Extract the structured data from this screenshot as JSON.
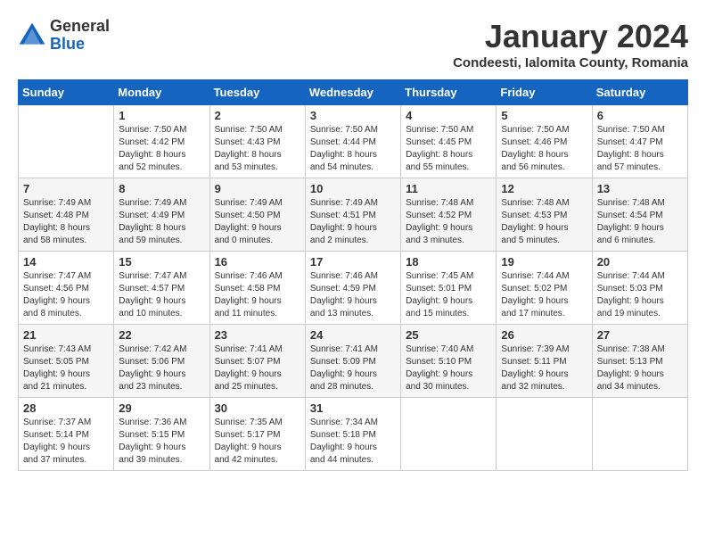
{
  "logo": {
    "general": "General",
    "blue": "Blue"
  },
  "title": "January 2024",
  "subtitle": "Condeesti, Ialomita County, Romania",
  "days_of_week": [
    "Sunday",
    "Monday",
    "Tuesday",
    "Wednesday",
    "Thursday",
    "Friday",
    "Saturday"
  ],
  "weeks": [
    [
      {
        "number": "",
        "info": ""
      },
      {
        "number": "1",
        "info": "Sunrise: 7:50 AM\nSunset: 4:42 PM\nDaylight: 8 hours\nand 52 minutes."
      },
      {
        "number": "2",
        "info": "Sunrise: 7:50 AM\nSunset: 4:43 PM\nDaylight: 8 hours\nand 53 minutes."
      },
      {
        "number": "3",
        "info": "Sunrise: 7:50 AM\nSunset: 4:44 PM\nDaylight: 8 hours\nand 54 minutes."
      },
      {
        "number": "4",
        "info": "Sunrise: 7:50 AM\nSunset: 4:45 PM\nDaylight: 8 hours\nand 55 minutes."
      },
      {
        "number": "5",
        "info": "Sunrise: 7:50 AM\nSunset: 4:46 PM\nDaylight: 8 hours\nand 56 minutes."
      },
      {
        "number": "6",
        "info": "Sunrise: 7:50 AM\nSunset: 4:47 PM\nDaylight: 8 hours\nand 57 minutes."
      }
    ],
    [
      {
        "number": "7",
        "info": "Sunrise: 7:49 AM\nSunset: 4:48 PM\nDaylight: 8 hours\nand 58 minutes."
      },
      {
        "number": "8",
        "info": "Sunrise: 7:49 AM\nSunset: 4:49 PM\nDaylight: 8 hours\nand 59 minutes."
      },
      {
        "number": "9",
        "info": "Sunrise: 7:49 AM\nSunset: 4:50 PM\nDaylight: 9 hours\nand 0 minutes."
      },
      {
        "number": "10",
        "info": "Sunrise: 7:49 AM\nSunset: 4:51 PM\nDaylight: 9 hours\nand 2 minutes."
      },
      {
        "number": "11",
        "info": "Sunrise: 7:48 AM\nSunset: 4:52 PM\nDaylight: 9 hours\nand 3 minutes."
      },
      {
        "number": "12",
        "info": "Sunrise: 7:48 AM\nSunset: 4:53 PM\nDaylight: 9 hours\nand 5 minutes."
      },
      {
        "number": "13",
        "info": "Sunrise: 7:48 AM\nSunset: 4:54 PM\nDaylight: 9 hours\nand 6 minutes."
      }
    ],
    [
      {
        "number": "14",
        "info": "Sunrise: 7:47 AM\nSunset: 4:56 PM\nDaylight: 9 hours\nand 8 minutes."
      },
      {
        "number": "15",
        "info": "Sunrise: 7:47 AM\nSunset: 4:57 PM\nDaylight: 9 hours\nand 10 minutes."
      },
      {
        "number": "16",
        "info": "Sunrise: 7:46 AM\nSunset: 4:58 PM\nDaylight: 9 hours\nand 11 minutes."
      },
      {
        "number": "17",
        "info": "Sunrise: 7:46 AM\nSunset: 4:59 PM\nDaylight: 9 hours\nand 13 minutes."
      },
      {
        "number": "18",
        "info": "Sunrise: 7:45 AM\nSunset: 5:01 PM\nDaylight: 9 hours\nand 15 minutes."
      },
      {
        "number": "19",
        "info": "Sunrise: 7:44 AM\nSunset: 5:02 PM\nDaylight: 9 hours\nand 17 minutes."
      },
      {
        "number": "20",
        "info": "Sunrise: 7:44 AM\nSunset: 5:03 PM\nDaylight: 9 hours\nand 19 minutes."
      }
    ],
    [
      {
        "number": "21",
        "info": "Sunrise: 7:43 AM\nSunset: 5:05 PM\nDaylight: 9 hours\nand 21 minutes."
      },
      {
        "number": "22",
        "info": "Sunrise: 7:42 AM\nSunset: 5:06 PM\nDaylight: 9 hours\nand 23 minutes."
      },
      {
        "number": "23",
        "info": "Sunrise: 7:41 AM\nSunset: 5:07 PM\nDaylight: 9 hours\nand 25 minutes."
      },
      {
        "number": "24",
        "info": "Sunrise: 7:41 AM\nSunset: 5:09 PM\nDaylight: 9 hours\nand 28 minutes."
      },
      {
        "number": "25",
        "info": "Sunrise: 7:40 AM\nSunset: 5:10 PM\nDaylight: 9 hours\nand 30 minutes."
      },
      {
        "number": "26",
        "info": "Sunrise: 7:39 AM\nSunset: 5:11 PM\nDaylight: 9 hours\nand 32 minutes."
      },
      {
        "number": "27",
        "info": "Sunrise: 7:38 AM\nSunset: 5:13 PM\nDaylight: 9 hours\nand 34 minutes."
      }
    ],
    [
      {
        "number": "28",
        "info": "Sunrise: 7:37 AM\nSunset: 5:14 PM\nDaylight: 9 hours\nand 37 minutes."
      },
      {
        "number": "29",
        "info": "Sunrise: 7:36 AM\nSunset: 5:15 PM\nDaylight: 9 hours\nand 39 minutes."
      },
      {
        "number": "30",
        "info": "Sunrise: 7:35 AM\nSunset: 5:17 PM\nDaylight: 9 hours\nand 42 minutes."
      },
      {
        "number": "31",
        "info": "Sunrise: 7:34 AM\nSunset: 5:18 PM\nDaylight: 9 hours\nand 44 minutes."
      },
      {
        "number": "",
        "info": ""
      },
      {
        "number": "",
        "info": ""
      },
      {
        "number": "",
        "info": ""
      }
    ]
  ]
}
